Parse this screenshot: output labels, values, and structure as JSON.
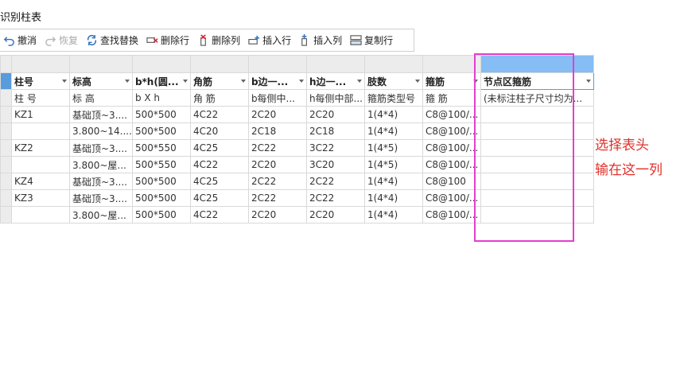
{
  "title": "识别柱表",
  "toolbar": {
    "items": [
      {
        "label": "撤消",
        "icon": "undo-icon",
        "enabled": true
      },
      {
        "label": "恢复",
        "icon": "redo-icon",
        "enabled": false
      },
      {
        "label": "查找替换",
        "icon": "find-replace-icon",
        "enabled": true
      },
      {
        "label": "删除行",
        "icon": "delete-row-icon",
        "enabled": true
      },
      {
        "label": "删除列",
        "icon": "delete-column-icon",
        "enabled": true
      },
      {
        "label": "插入行",
        "icon": "insert-row-icon",
        "enabled": true
      },
      {
        "label": "插入列",
        "icon": "insert-column-icon",
        "enabled": true
      },
      {
        "label": "复制行",
        "icon": "copy-row-icon",
        "enabled": true
      }
    ]
  },
  "table": {
    "headers": [
      "柱号",
      "标高",
      "b*h(圆...",
      "角筋",
      "b边一...",
      "h边一...",
      "肢数",
      "箍筋",
      "节点区箍筋"
    ],
    "subheaders": [
      "柱 号",
      "标 高",
      "b X h",
      "角 筋",
      "b每侧中...",
      "h每侧中部...",
      "箍筋类型号",
      "箍 筋",
      "(未标注柱子尺寸均为..."
    ],
    "rows": [
      [
        "KZ1",
        "基础顶~3....",
        "500*500",
        "4C22",
        "2C20",
        "2C20",
        "1(4*4)",
        "C8@100/...",
        ""
      ],
      [
        "",
        "3.800~14....",
        "500*500",
        "4C20",
        "2C18",
        "2C18",
        "1(4*4)",
        "C8@100/...",
        ""
      ],
      [
        "KZ2",
        "基础顶~3....",
        "500*550",
        "4C25",
        "2C22",
        "3C22",
        "1(4*5)",
        "C8@100/...",
        ""
      ],
      [
        "",
        "3.800~屋...",
        "500*550",
        "4C22",
        "2C20",
        "3C20",
        "1(4*5)",
        "C8@100/...",
        ""
      ],
      [
        "KZ4",
        "基础顶~3....",
        "500*500",
        "4C25",
        "2C22",
        "2C22",
        "1(4*4)",
        "C8@100",
        ""
      ],
      [
        "KZ3",
        "基础顶~3....",
        "500*500",
        "4C25",
        "2C22",
        "2C22",
        "1(4*4)",
        "C8@100/...",
        ""
      ],
      [
        "",
        "3.800~屋...",
        "500*500",
        "4C22",
        "2C20",
        "2C20",
        "1(4*4)",
        "C8@100/...",
        ""
      ]
    ]
  },
  "annotation": {
    "line1": "选择表头",
    "line2": "输在这一列",
    "color": "#e0302a",
    "box_color": "#e23fd0"
  }
}
